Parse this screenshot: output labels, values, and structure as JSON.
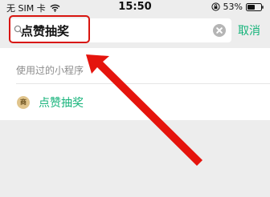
{
  "status_bar": {
    "carrier": "无 SIM 卡",
    "time": "15:50",
    "battery": "53%"
  },
  "search": {
    "value": "点赞抽奖",
    "cancel_label": "取消"
  },
  "results": {
    "section_title": "使用过的小程序",
    "items": [
      {
        "logo_text": "商",
        "name": "点赞抽奖"
      }
    ]
  },
  "colors": {
    "accent_green": "#15b37a",
    "highlight_red": "#d8150f",
    "bar_gray": "#ededed"
  },
  "icons": [
    "wifi-icon",
    "lock-rotation-icon",
    "battery-icon",
    "search-icon",
    "clear-icon",
    "arrow-annotation"
  ]
}
